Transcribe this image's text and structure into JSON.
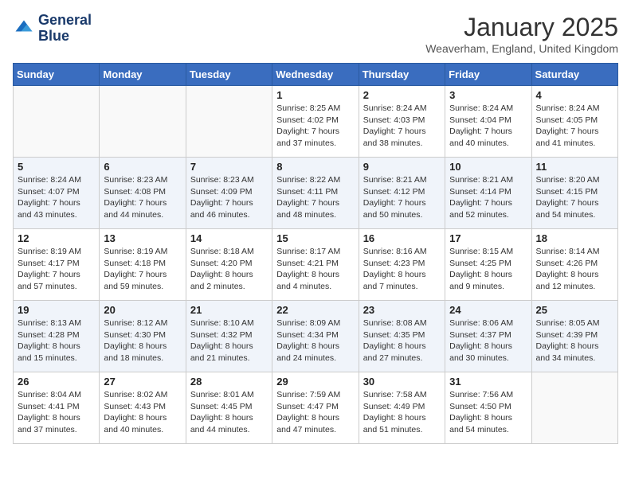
{
  "header": {
    "logo_line1": "General",
    "logo_line2": "Blue",
    "month": "January 2025",
    "location": "Weaverham, England, United Kingdom"
  },
  "weekdays": [
    "Sunday",
    "Monday",
    "Tuesday",
    "Wednesday",
    "Thursday",
    "Friday",
    "Saturday"
  ],
  "weeks": [
    [
      {
        "day": "",
        "sunrise": "",
        "sunset": "",
        "daylight": ""
      },
      {
        "day": "",
        "sunrise": "",
        "sunset": "",
        "daylight": ""
      },
      {
        "day": "",
        "sunrise": "",
        "sunset": "",
        "daylight": ""
      },
      {
        "day": "1",
        "sunrise": "Sunrise: 8:25 AM",
        "sunset": "Sunset: 4:02 PM",
        "daylight": "Daylight: 7 hours and 37 minutes."
      },
      {
        "day": "2",
        "sunrise": "Sunrise: 8:24 AM",
        "sunset": "Sunset: 4:03 PM",
        "daylight": "Daylight: 7 hours and 38 minutes."
      },
      {
        "day": "3",
        "sunrise": "Sunrise: 8:24 AM",
        "sunset": "Sunset: 4:04 PM",
        "daylight": "Daylight: 7 hours and 40 minutes."
      },
      {
        "day": "4",
        "sunrise": "Sunrise: 8:24 AM",
        "sunset": "Sunset: 4:05 PM",
        "daylight": "Daylight: 7 hours and 41 minutes."
      }
    ],
    [
      {
        "day": "5",
        "sunrise": "Sunrise: 8:24 AM",
        "sunset": "Sunset: 4:07 PM",
        "daylight": "Daylight: 7 hours and 43 minutes."
      },
      {
        "day": "6",
        "sunrise": "Sunrise: 8:23 AM",
        "sunset": "Sunset: 4:08 PM",
        "daylight": "Daylight: 7 hours and 44 minutes."
      },
      {
        "day": "7",
        "sunrise": "Sunrise: 8:23 AM",
        "sunset": "Sunset: 4:09 PM",
        "daylight": "Daylight: 7 hours and 46 minutes."
      },
      {
        "day": "8",
        "sunrise": "Sunrise: 8:22 AM",
        "sunset": "Sunset: 4:11 PM",
        "daylight": "Daylight: 7 hours and 48 minutes."
      },
      {
        "day": "9",
        "sunrise": "Sunrise: 8:21 AM",
        "sunset": "Sunset: 4:12 PM",
        "daylight": "Daylight: 7 hours and 50 minutes."
      },
      {
        "day": "10",
        "sunrise": "Sunrise: 8:21 AM",
        "sunset": "Sunset: 4:14 PM",
        "daylight": "Daylight: 7 hours and 52 minutes."
      },
      {
        "day": "11",
        "sunrise": "Sunrise: 8:20 AM",
        "sunset": "Sunset: 4:15 PM",
        "daylight": "Daylight: 7 hours and 54 minutes."
      }
    ],
    [
      {
        "day": "12",
        "sunrise": "Sunrise: 8:19 AM",
        "sunset": "Sunset: 4:17 PM",
        "daylight": "Daylight: 7 hours and 57 minutes."
      },
      {
        "day": "13",
        "sunrise": "Sunrise: 8:19 AM",
        "sunset": "Sunset: 4:18 PM",
        "daylight": "Daylight: 7 hours and 59 minutes."
      },
      {
        "day": "14",
        "sunrise": "Sunrise: 8:18 AM",
        "sunset": "Sunset: 4:20 PM",
        "daylight": "Daylight: 8 hours and 2 minutes."
      },
      {
        "day": "15",
        "sunrise": "Sunrise: 8:17 AM",
        "sunset": "Sunset: 4:21 PM",
        "daylight": "Daylight: 8 hours and 4 minutes."
      },
      {
        "day": "16",
        "sunrise": "Sunrise: 8:16 AM",
        "sunset": "Sunset: 4:23 PM",
        "daylight": "Daylight: 8 hours and 7 minutes."
      },
      {
        "day": "17",
        "sunrise": "Sunrise: 8:15 AM",
        "sunset": "Sunset: 4:25 PM",
        "daylight": "Daylight: 8 hours and 9 minutes."
      },
      {
        "day": "18",
        "sunrise": "Sunrise: 8:14 AM",
        "sunset": "Sunset: 4:26 PM",
        "daylight": "Daylight: 8 hours and 12 minutes."
      }
    ],
    [
      {
        "day": "19",
        "sunrise": "Sunrise: 8:13 AM",
        "sunset": "Sunset: 4:28 PM",
        "daylight": "Daylight: 8 hours and 15 minutes."
      },
      {
        "day": "20",
        "sunrise": "Sunrise: 8:12 AM",
        "sunset": "Sunset: 4:30 PM",
        "daylight": "Daylight: 8 hours and 18 minutes."
      },
      {
        "day": "21",
        "sunrise": "Sunrise: 8:10 AM",
        "sunset": "Sunset: 4:32 PM",
        "daylight": "Daylight: 8 hours and 21 minutes."
      },
      {
        "day": "22",
        "sunrise": "Sunrise: 8:09 AM",
        "sunset": "Sunset: 4:34 PM",
        "daylight": "Daylight: 8 hours and 24 minutes."
      },
      {
        "day": "23",
        "sunrise": "Sunrise: 8:08 AM",
        "sunset": "Sunset: 4:35 PM",
        "daylight": "Daylight: 8 hours and 27 minutes."
      },
      {
        "day": "24",
        "sunrise": "Sunrise: 8:06 AM",
        "sunset": "Sunset: 4:37 PM",
        "daylight": "Daylight: 8 hours and 30 minutes."
      },
      {
        "day": "25",
        "sunrise": "Sunrise: 8:05 AM",
        "sunset": "Sunset: 4:39 PM",
        "daylight": "Daylight: 8 hours and 34 minutes."
      }
    ],
    [
      {
        "day": "26",
        "sunrise": "Sunrise: 8:04 AM",
        "sunset": "Sunset: 4:41 PM",
        "daylight": "Daylight: 8 hours and 37 minutes."
      },
      {
        "day": "27",
        "sunrise": "Sunrise: 8:02 AM",
        "sunset": "Sunset: 4:43 PM",
        "daylight": "Daylight: 8 hours and 40 minutes."
      },
      {
        "day": "28",
        "sunrise": "Sunrise: 8:01 AM",
        "sunset": "Sunset: 4:45 PM",
        "daylight": "Daylight: 8 hours and 44 minutes."
      },
      {
        "day": "29",
        "sunrise": "Sunrise: 7:59 AM",
        "sunset": "Sunset: 4:47 PM",
        "daylight": "Daylight: 8 hours and 47 minutes."
      },
      {
        "day": "30",
        "sunrise": "Sunrise: 7:58 AM",
        "sunset": "Sunset: 4:49 PM",
        "daylight": "Daylight: 8 hours and 51 minutes."
      },
      {
        "day": "31",
        "sunrise": "Sunrise: 7:56 AM",
        "sunset": "Sunset: 4:50 PM",
        "daylight": "Daylight: 8 hours and 54 minutes."
      },
      {
        "day": "",
        "sunrise": "",
        "sunset": "",
        "daylight": ""
      }
    ]
  ]
}
